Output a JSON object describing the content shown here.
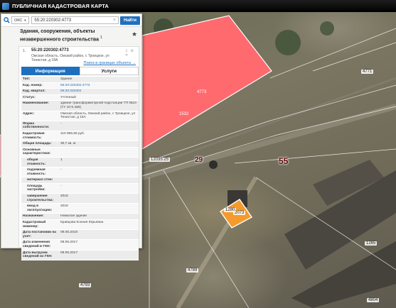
{
  "header": {
    "title": "ПУБЛИЧНАЯ КАДАСТРОВАЯ КАРТА"
  },
  "search": {
    "type_selected": "ОКС",
    "query": "55:20:220302:4773",
    "clear": "×",
    "button_label": "Найти"
  },
  "panel": {
    "category_title": "Здания, сооружения, объекты незавершенного строительства",
    "category_count": "1"
  },
  "result": {
    "index": "1.",
    "cadastral_number": "55:20:220302:4773",
    "address": "Омская область, Омский район, с Троицкое, ул Тенистая, д 18А",
    "search_link": "Поиск в границах объекта →",
    "tabs": [
      {
        "label": "Информация",
        "active": true
      },
      {
        "label": "Услуги",
        "active": false
      }
    ],
    "rows": [
      {
        "key": "Тип:",
        "value": "Здание",
        "blue": false,
        "sub": false
      },
      {
        "key": "Кад. номер:",
        "value": "55:20:220302:4773",
        "blue": true,
        "sub": false
      },
      {
        "key": "Кад. квартал:",
        "value": "55:20:220302",
        "blue": true,
        "sub": false
      },
      {
        "key": "Статус:",
        "value": "Учтенный",
        "blue": false,
        "sub": false
      },
      {
        "key": "Наименование:",
        "value": "здание трансформаторной подстанции ТП №10 (ГУ 10-0,4кВ)",
        "blue": false,
        "sub": false
      },
      {
        "key": "Адрес:",
        "value": "Омская область, Омский район, с Троицкое, ул Тенистая, д 18А",
        "blue": false,
        "sub": false
      },
      {
        "key": "Форма собственности:",
        "value": "-",
        "blue": false,
        "sub": false
      },
      {
        "key": "Кадастровая стоимость:",
        "value": "110 956,56 руб.",
        "blue": false,
        "sub": false
      },
      {
        "key": "Общая площадь:",
        "value": "30,7 кв. м",
        "blue": false,
        "sub": false
      },
      {
        "key": "Основные характеристики:",
        "value": "",
        "blue": false,
        "sub": false
      },
      {
        "key": "общая этажность:",
        "value": "1",
        "blue": false,
        "sub": true
      },
      {
        "key": "подземная этажность:",
        "value": "-",
        "blue": false,
        "sub": true
      },
      {
        "key": "материал стен:",
        "value": "",
        "blue": false,
        "sub": true
      },
      {
        "key": "площадь застройки:",
        "value": "-",
        "blue": false,
        "sub": true
      },
      {
        "key": "завершение строительства:",
        "value": "2018",
        "blue": false,
        "sub": true
      },
      {
        "key": "ввод в эксплуатацию:",
        "value": "2018",
        "blue": false,
        "sub": true
      },
      {
        "key": "Назначение:",
        "value": "Нежилое здание",
        "blue": false,
        "sub": false
      },
      {
        "key": "Кадастровый инженер:",
        "value": "Кравцова Ксения Юрьевна",
        "blue": false,
        "sub": false
      },
      {
        "key": "Дата постановки на учет:",
        "value": "09.06.2018",
        "blue": false,
        "sub": false
      },
      {
        "key": "Дата изменения сведений в ГКН:",
        "value": "08.06.2017",
        "blue": false,
        "sub": false
      },
      {
        "key": "Дата выгрузки сведений из ГКН:",
        "value": "09.06.2017",
        "blue": false,
        "sub": false
      }
    ]
  },
  "map": {
    "label_4773": "4773",
    "label_4771": "4771",
    "label_1532": "1532",
    "label_4789": "4789",
    "label_4793": "4793",
    "label_4804": "4804",
    "label_29": "29",
    "label_55": "55",
    "label_1280": "1280",
    "label_1265": "1265",
    "label_2073": "2073",
    "label_120355": "12035:25",
    "highlight_color": "#ff6a6e",
    "selected_color": "#f59a2d",
    "parcel_line_color": "#ffffff"
  },
  "icons": {
    "search": "search-icon",
    "star": "star-icon",
    "logo": "logo-icon"
  }
}
